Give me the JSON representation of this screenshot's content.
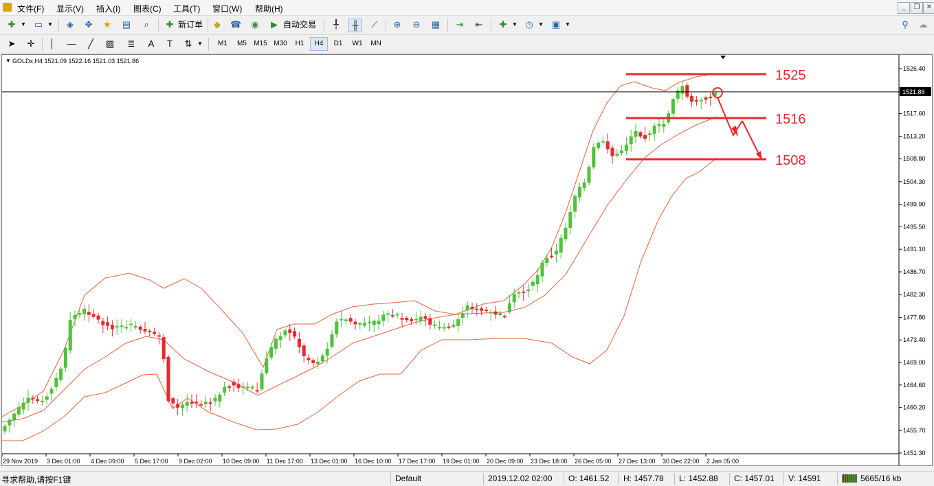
{
  "menu": [
    "文件(F)",
    "显示(V)",
    "插入(I)",
    "图表(C)",
    "工具(T)",
    "窗口(W)",
    "帮助(H)"
  ],
  "toolbar": {
    "new_order": "新订单",
    "auto_trading": "自动交易"
  },
  "timeframes": [
    "M1",
    "M5",
    "M15",
    "M30",
    "H1",
    "H4",
    "D1",
    "W1",
    "MN"
  ],
  "active_timeframe": "H4",
  "chart": {
    "symbol_info": "GOLDx,H4  1521.09 1522.16 1521.03 1521.86",
    "current_price_label": "1521.86",
    "y_ticks": [
      "1526.40",
      "1521.86",
      "1517.60",
      "1513.20",
      "1508.80",
      "1504.30",
      "1499.90",
      "1495.50",
      "1491.10",
      "1486.70",
      "1482.30",
      "1477.80",
      "1473.40",
      "1469.00",
      "1464.60",
      "1460.20",
      "1455.70",
      "1451.30"
    ],
    "x_ticks": [
      "29 Nov 2019",
      "3 Dec 01:00",
      "4 Dec 09:00",
      "5 Dec 17:00",
      "9 Dec 02:00",
      "10 Dec 09:00",
      "11 Dec 17:00",
      "13 Dec 01:00",
      "16 Dec 10:00",
      "17 Dec 17:00",
      "19 Dec 01:00",
      "20 Dec 09:00",
      "23 Dec 18:00",
      "26 Dec 05:00",
      "27 Dec 13:00",
      "30 Dec 22:00",
      "2 Jan 05:00"
    ],
    "levels": [
      {
        "label": "1525",
        "price": 1525
      },
      {
        "label": "1516",
        "price": 1516.6
      },
      {
        "label": "1508",
        "price": 1508.6
      }
    ],
    "colors": {
      "bull": "#4fc23a",
      "bear": "#e8282b",
      "band": "#e8613a",
      "level": "#e8282b"
    }
  },
  "status": {
    "help": "寻求帮助,请按F1键",
    "profile": "Default",
    "datetime": "2019.12.02 02:00",
    "open": "O: 1461.52",
    "high": "H: 1457.78",
    "low": "L: 1452.88",
    "close": "C: 1457.01",
    "volume": "V: 14591",
    "traffic": "5665/16 kb"
  }
}
